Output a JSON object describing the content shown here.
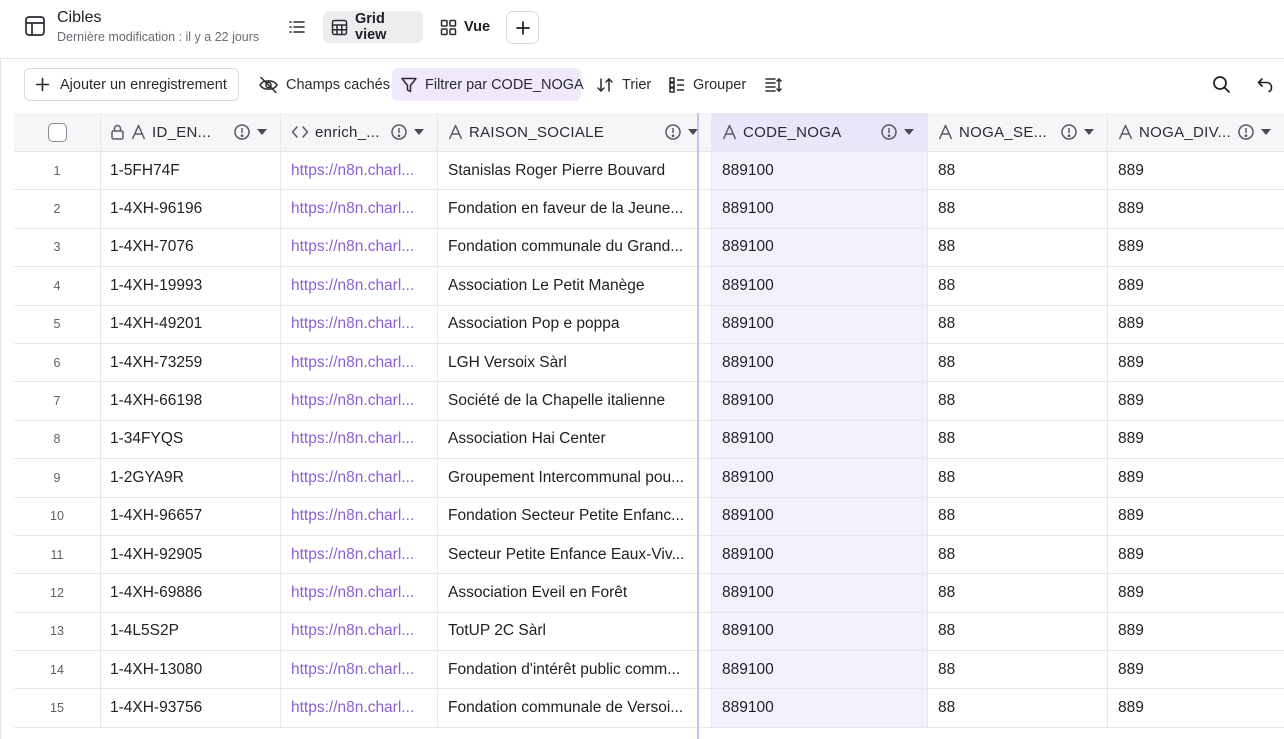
{
  "header": {
    "title": "Cibles",
    "subtitle": "Dernière modification : il y a 22 jours",
    "views": [
      {
        "label": "Grid view",
        "icon": "grid-icon",
        "active": true
      },
      {
        "label": "Vue",
        "icon": "layout-icon",
        "active": false
      }
    ]
  },
  "toolbar": {
    "add_label": "Ajouter un enregistrement",
    "hidden_label": "Champs cachés",
    "filter_label": "Filtrer par CODE_NOGA",
    "sort_label": "Trier",
    "group_label": "Grouper"
  },
  "columns": [
    {
      "label": "ID_EN...",
      "icon": "text-icon",
      "locked": true
    },
    {
      "label": "enrich_...",
      "icon": "code-icon"
    },
    {
      "label": "RAISON_SOCIALE",
      "icon": "text-icon"
    },
    {
      "label": "CODE_NOGA",
      "icon": "text-icon",
      "filtered": true
    },
    {
      "label": "NOGA_SE...",
      "icon": "text-icon"
    },
    {
      "label": "NOGA_DIV...",
      "icon": "text-icon"
    }
  ],
  "rows": [
    {
      "num": "1",
      "id": "1-5FH74F",
      "enrich": "https://n8n.charl...",
      "raison": "Stanislas Roger Pierre Bouvard",
      "code": "889100",
      "sect": "88",
      "div": "889"
    },
    {
      "num": "2",
      "id": "1-4XH-96196",
      "enrich": "https://n8n.charl...",
      "raison": "Fondation en faveur de la Jeune...",
      "code": "889100",
      "sect": "88",
      "div": "889"
    },
    {
      "num": "3",
      "id": "1-4XH-7076",
      "enrich": "https://n8n.charl...",
      "raison": "Fondation communale du Grand...",
      "code": "889100",
      "sect": "88",
      "div": "889"
    },
    {
      "num": "4",
      "id": "1-4XH-19993",
      "enrich": "https://n8n.charl...",
      "raison": "Association Le Petit Manège",
      "code": "889100",
      "sect": "88",
      "div": "889"
    },
    {
      "num": "5",
      "id": "1-4XH-49201",
      "enrich": "https://n8n.charl...",
      "raison": "Association Pop e poppa",
      "code": "889100",
      "sect": "88",
      "div": "889"
    },
    {
      "num": "6",
      "id": "1-4XH-73259",
      "enrich": "https://n8n.charl...",
      "raison": "LGH Versoix Sàrl",
      "code": "889100",
      "sect": "88",
      "div": "889"
    },
    {
      "num": "7",
      "id": "1-4XH-66198",
      "enrich": "https://n8n.charl...",
      "raison": "Société de la Chapelle italienne",
      "code": "889100",
      "sect": "88",
      "div": "889"
    },
    {
      "num": "8",
      "id": "1-34FYQS",
      "enrich": "https://n8n.charl...",
      "raison": "Association Hai Center",
      "code": "889100",
      "sect": "88",
      "div": "889"
    },
    {
      "num": "9",
      "id": "1-2GYA9R",
      "enrich": "https://n8n.charl...",
      "raison": "Groupement Intercommunal pou...",
      "code": "889100",
      "sect": "88",
      "div": "889"
    },
    {
      "num": "10",
      "id": "1-4XH-96657",
      "enrich": "https://n8n.charl...",
      "raison": "Fondation Secteur Petite Enfanc...",
      "code": "889100",
      "sect": "88",
      "div": "889"
    },
    {
      "num": "11",
      "id": "1-4XH-92905",
      "enrich": "https://n8n.charl...",
      "raison": "Secteur Petite Enfance Eaux-Viv...",
      "code": "889100",
      "sect": "88",
      "div": "889"
    },
    {
      "num": "12",
      "id": "1-4XH-69886",
      "enrich": "https://n8n.charl...",
      "raison": "Association Eveil en Forêt",
      "code": "889100",
      "sect": "88",
      "div": "889"
    },
    {
      "num": "13",
      "id": "1-4L5S2P",
      "enrich": "https://n8n.charl...",
      "raison": "TotUP 2C Sàrl",
      "code": "889100",
      "sect": "88",
      "div": "889"
    },
    {
      "num": "14",
      "id": "1-4XH-13080",
      "enrich": "https://n8n.charl...",
      "raison": "Fondation d'intérêt public comm...",
      "code": "889100",
      "sect": "88",
      "div": "889"
    },
    {
      "num": "15",
      "id": "1-4XH-93756",
      "enrich": "https://n8n.charl...",
      "raison": "Fondation communale de Versoi...",
      "code": "889100",
      "sect": "88",
      "div": "889"
    }
  ],
  "colors": {
    "accent": "#8b5fd6",
    "filter_bg": "#efe9fb",
    "filtered_column_bg": "#f4f1fd"
  }
}
